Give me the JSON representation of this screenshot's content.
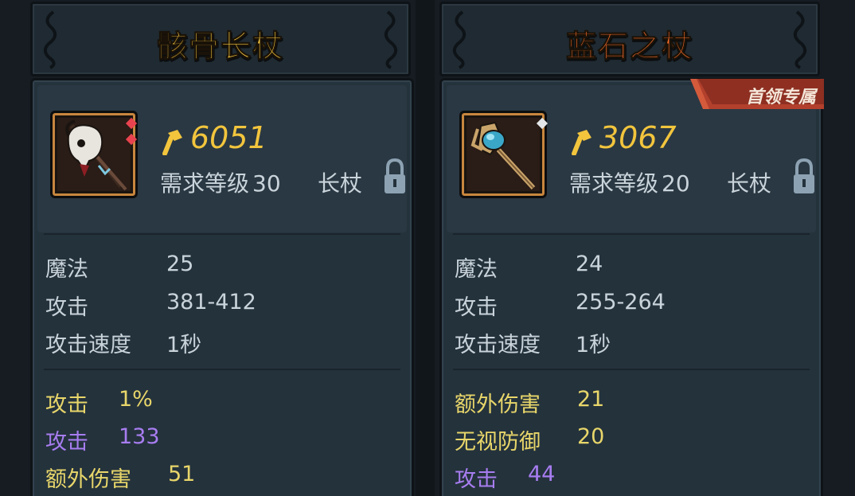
{
  "cards": [
    {
      "title": "骸骨长杖",
      "title_color": "#f2c53d",
      "icon": "skull-staff-icon",
      "power": "6051",
      "req_label": "需求等级",
      "req_level": "30",
      "item_type": "长杖",
      "base_stats": [
        {
          "label": "魔法",
          "value": "25"
        },
        {
          "label": "攻击",
          "value": "381-412"
        },
        {
          "label": "攻击速度",
          "value": "1秒"
        }
      ],
      "bonus_stats": [
        {
          "label": "攻击",
          "value": "1%",
          "color": "yellow"
        },
        {
          "label": "攻击",
          "value": "133",
          "color": "purple"
        },
        {
          "label": "额外伤害",
          "value": "51",
          "color": "yellow"
        }
      ]
    },
    {
      "title": "蓝石之杖",
      "title_color": "#f36a2a",
      "icon": "blue-stone-staff-icon",
      "boss_tag": "首领专属",
      "power": "3067",
      "req_label": "需求等级",
      "req_level": "20",
      "item_type": "长杖",
      "base_stats": [
        {
          "label": "魔法",
          "value": "24"
        },
        {
          "label": "攻击",
          "value": "255-264"
        },
        {
          "label": "攻击速度",
          "value": "1秒"
        }
      ],
      "bonus_stats": [
        {
          "label": "额外伤害",
          "value": "21",
          "color": "yellow"
        },
        {
          "label": "无视防御",
          "value": "20",
          "color": "yellow"
        },
        {
          "label": "攻击",
          "value": "44",
          "color": "purple"
        }
      ]
    }
  ],
  "colors": {
    "yellow": "#e8d66a",
    "purple": "#a77df0",
    "gold": "#f2c53d"
  }
}
